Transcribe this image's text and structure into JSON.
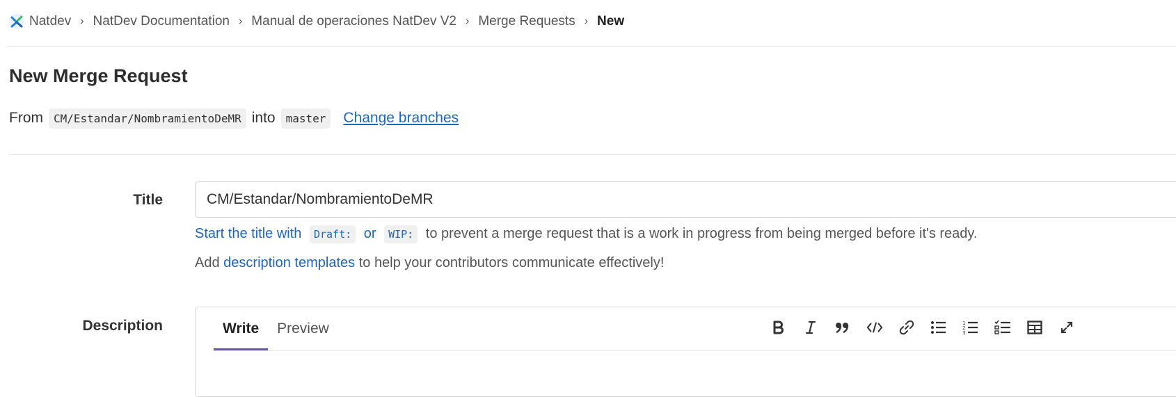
{
  "breadcrumb": {
    "items": [
      "Natdev",
      "NatDev Documentation",
      "Manual de operaciones NatDev V2",
      "Merge Requests"
    ],
    "current": "New",
    "separator": "›"
  },
  "page": {
    "title": "New Merge Request"
  },
  "branches": {
    "from_label": "From",
    "source": "CM/Estandar/NombramientoDeMR",
    "into_label": "into",
    "target": "master",
    "change_link": "Change branches"
  },
  "form": {
    "title_label": "Title",
    "title_value": "CM/Estandar/NombramientoDeMR",
    "draft_hint": {
      "lead_link": "Start the title with",
      "draft_tag": "Draft:",
      "or_link": "or",
      "wip_tag": "WIP:",
      "rest": "to prevent a merge request that is a work in progress from being merged before it's ready."
    },
    "templates_hint": {
      "prefix": "Add",
      "link": "description templates",
      "suffix": "to help your contributors communicate effectively!"
    },
    "description_label": "Description",
    "tabs": {
      "write": "Write",
      "preview": "Preview"
    },
    "toolbar_icons": [
      "bold-icon",
      "italic-icon",
      "quote-icon",
      "code-icon",
      "link-icon",
      "bullet-list-icon",
      "numbered-list-icon",
      "task-list-icon",
      "table-icon",
      "fullscreen-icon"
    ]
  },
  "colors": {
    "link": "#1f66b8",
    "active_tab": "#6b4fbb"
  }
}
